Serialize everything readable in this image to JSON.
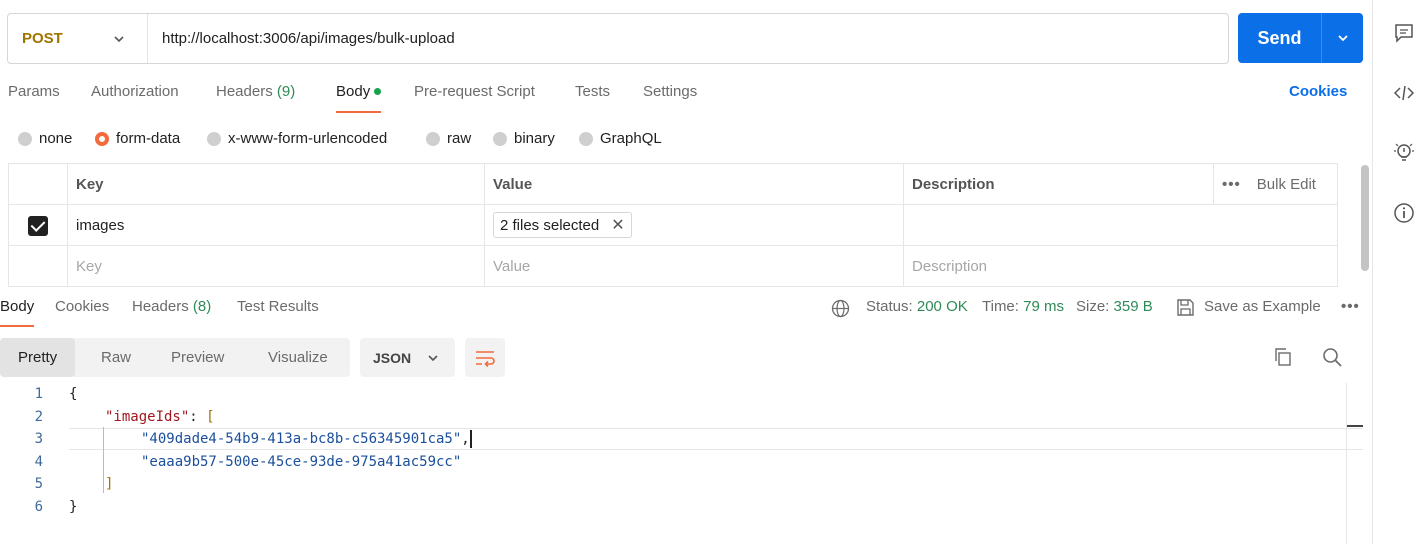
{
  "request": {
    "method": "POST",
    "url": "http://localhost:3006/api/images/bulk-upload",
    "send_label": "Send"
  },
  "request_tabs": [
    {
      "label": "Params"
    },
    {
      "label": "Authorization"
    },
    {
      "label": "Headers",
      "count": "(9)"
    },
    {
      "label": "Body"
    },
    {
      "label": "Pre-request Script"
    },
    {
      "label": "Tests"
    },
    {
      "label": "Settings"
    }
  ],
  "cookies_link": "Cookies",
  "body_types": [
    "none",
    "form-data",
    "x-www-form-urlencoded",
    "raw",
    "binary",
    "GraphQL"
  ],
  "body_type_selected": "form-data",
  "table": {
    "headers": {
      "key": "Key",
      "value": "Value",
      "description": "Description",
      "bulk_edit": "Bulk Edit",
      "more": "•••"
    },
    "row": {
      "key": "images",
      "value": "2 files selected",
      "remove": "✕"
    },
    "placeholders": {
      "key": "Key",
      "value": "Value",
      "description": "Description"
    }
  },
  "response_tabs": [
    {
      "label": "Body"
    },
    {
      "label": "Cookies"
    },
    {
      "label": "Headers",
      "count": "(8)"
    },
    {
      "label": "Test Results"
    }
  ],
  "response_meta": {
    "status_label": "Status:",
    "status_value": "200 OK",
    "time_label": "Time:",
    "time_value": "79 ms",
    "size_label": "Size:",
    "size_value": "359 B",
    "save_label": "Save as Example",
    "more": "•••"
  },
  "formats": [
    "Pretty",
    "Raw",
    "Preview",
    "Visualize"
  ],
  "format_selected": "Pretty",
  "language": "JSON",
  "code": {
    "line_numbers": [
      "1",
      "2",
      "3",
      "4",
      "5",
      "6"
    ],
    "open_brace": "{",
    "key": "\"imageIds\"",
    "colon": ": ",
    "open_bracket": "[",
    "id1": "\"409dade4-54b9-413a-bc8b-c56345901ca5\"",
    "comma": ",",
    "id2": "\"eaaa9b57-500e-45ce-93de-975a41ac59cc\"",
    "close_bracket": "]",
    "close_brace": "}"
  },
  "icons": {
    "rail": [
      "comment-icon",
      "code-icon",
      "lightbulb-icon",
      "info-icon"
    ],
    "accent": "#f26b3a",
    "send_color": "#0b6fe8"
  }
}
